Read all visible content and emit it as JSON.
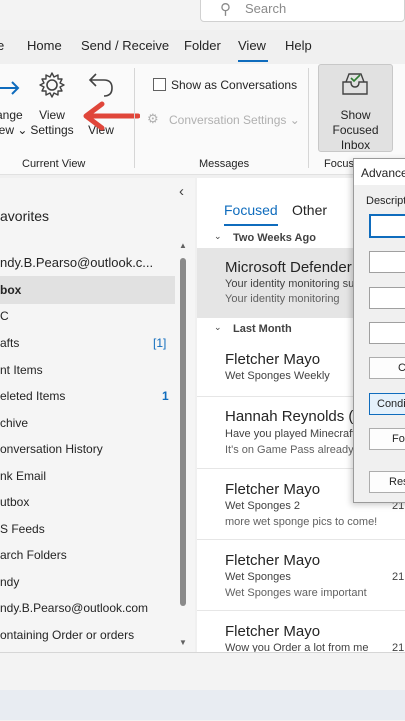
{
  "search": {
    "placeholder": "Search",
    "icon": "search-icon"
  },
  "menu": {
    "tabs": [
      "Home",
      "Send / Receive",
      "Folder",
      "View",
      "Help"
    ],
    "active": "View",
    "accent": "#0f6cbd"
  },
  "ribbon": {
    "change_view": {
      "line1": "ange",
      "line2": "iew ⌄"
    },
    "view_settings": {
      "line1": "View",
      "line2": "Settings"
    },
    "reset_view": {
      "line1": "View"
    },
    "show_as_conversations": "Show as Conversations",
    "conversation_settings": "Conversation Settings ⌄",
    "show_focused_inbox": {
      "line1": "Show Focused",
      "line2": "Inbox"
    },
    "groups": {
      "current_view": "Current View",
      "messages": "Messages",
      "focused": "Focuse"
    }
  },
  "nav": {
    "collapse": "‹",
    "favorites": "avorites",
    "account": "ndy.B.Pearso@outlook.c...",
    "items": [
      {
        "label": "box",
        "count": ""
      },
      {
        "label": "C",
        "count": ""
      },
      {
        "label": "afts",
        "count": "[1]"
      },
      {
        "label": "nt Items",
        "count": ""
      },
      {
        "label": "eleted Items",
        "count": "1"
      },
      {
        "label": "chive",
        "count": ""
      },
      {
        "label": "onversation History",
        "count": ""
      },
      {
        "label": "nk Email",
        "count": ""
      },
      {
        "label": "utbox",
        "count": ""
      },
      {
        "label": "S Feeds",
        "count": ""
      },
      {
        "label": "arch Folders",
        "count": ""
      },
      {
        "label": "ndy",
        "count": ""
      },
      {
        "label": "ndy.B.Pearso@outlook.com",
        "count": ""
      },
      {
        "label": "ontaining Order or orders",
        "count": ""
      }
    ]
  },
  "list": {
    "tabs": {
      "focused": "Focused",
      "other": "Other"
    },
    "groups": {
      "two_weeks": "Two Weeks Ago",
      "last_month": "Last Month"
    },
    "messages": [
      {
        "sender": "Microsoft Defender",
        "subject": "Your identity monitoring sun",
        "preview": "Your identity monitoring",
        "date": ""
      },
      {
        "sender": "Fletcher Mayo",
        "subject": "Wet Sponges Weekly",
        "preview": "",
        "date": ""
      },
      {
        "sender": "Hannah Reynolds (Re",
        "subject": "Have you played Minecraft L",
        "preview": "It's on Game Pass already! I'm",
        "date": ""
      },
      {
        "sender": "Fletcher Mayo",
        "subject": "Wet Sponges 2",
        "preview": "more wet sponge pics to come!",
        "date": "21"
      },
      {
        "sender": "Fletcher Mayo",
        "subject": "Wet Sponges",
        "preview": "Wet Sponges ware important",
        "date": "21"
      },
      {
        "sender": "Fletcher Mayo",
        "subject": "Wow you Order a lot from me",
        "preview": "",
        "date": "21"
      }
    ]
  },
  "dialog": {
    "title": "Advance",
    "description_label": "Descripti",
    "buttons": [
      "C",
      "Condi",
      "Fo",
      "Res"
    ]
  }
}
